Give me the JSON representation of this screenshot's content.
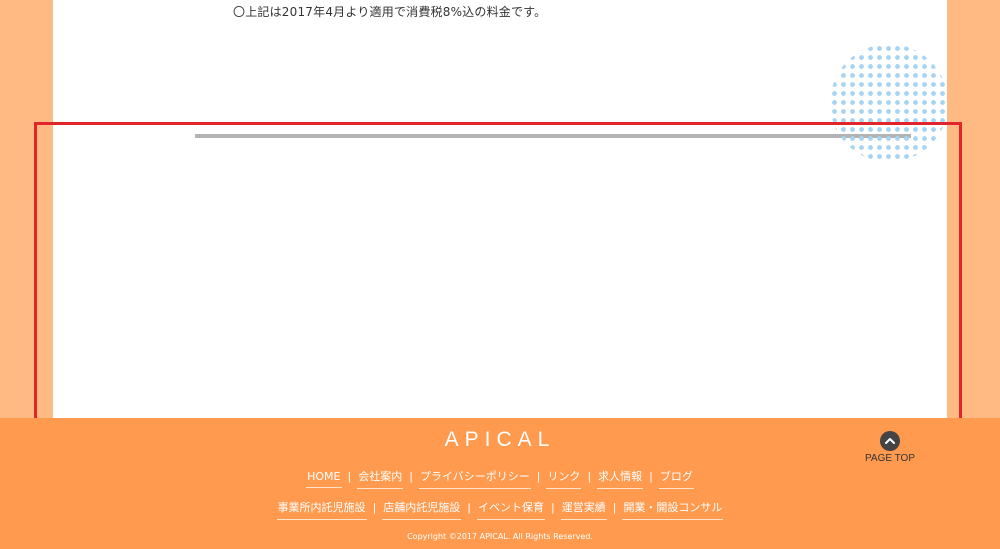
{
  "content": {
    "note": "〇上記は2017年4月より適用で消費税8%込の料金です。"
  },
  "footer": {
    "logo": "APICAL",
    "nav_row1": [
      {
        "label": "HOME"
      },
      {
        "label": "会社案内"
      },
      {
        "label": "プライバシーポリシー"
      },
      {
        "label": "リンク"
      },
      {
        "label": "求人情報"
      },
      {
        "label": "ブログ"
      }
    ],
    "nav_row2": [
      {
        "label": "事業所内託児施設"
      },
      {
        "label": "店舗内託児施設"
      },
      {
        "label": "イベント保育"
      },
      {
        "label": "運営実績"
      },
      {
        "label": "開業・開設コンサル"
      }
    ],
    "separator": "|",
    "copyright": "Copyright ©2017 APICAL. All Rights Reserved.",
    "page_top": {
      "label": "PAGE TOP",
      "icon": "chevron-up-icon"
    }
  },
  "colors": {
    "page_bg": "#ffb982",
    "footer_bg": "#ff9a4e",
    "highlight_border": "#e0262b",
    "dot_pattern": "#a8d4f2",
    "divider": "#b3b3b3"
  }
}
